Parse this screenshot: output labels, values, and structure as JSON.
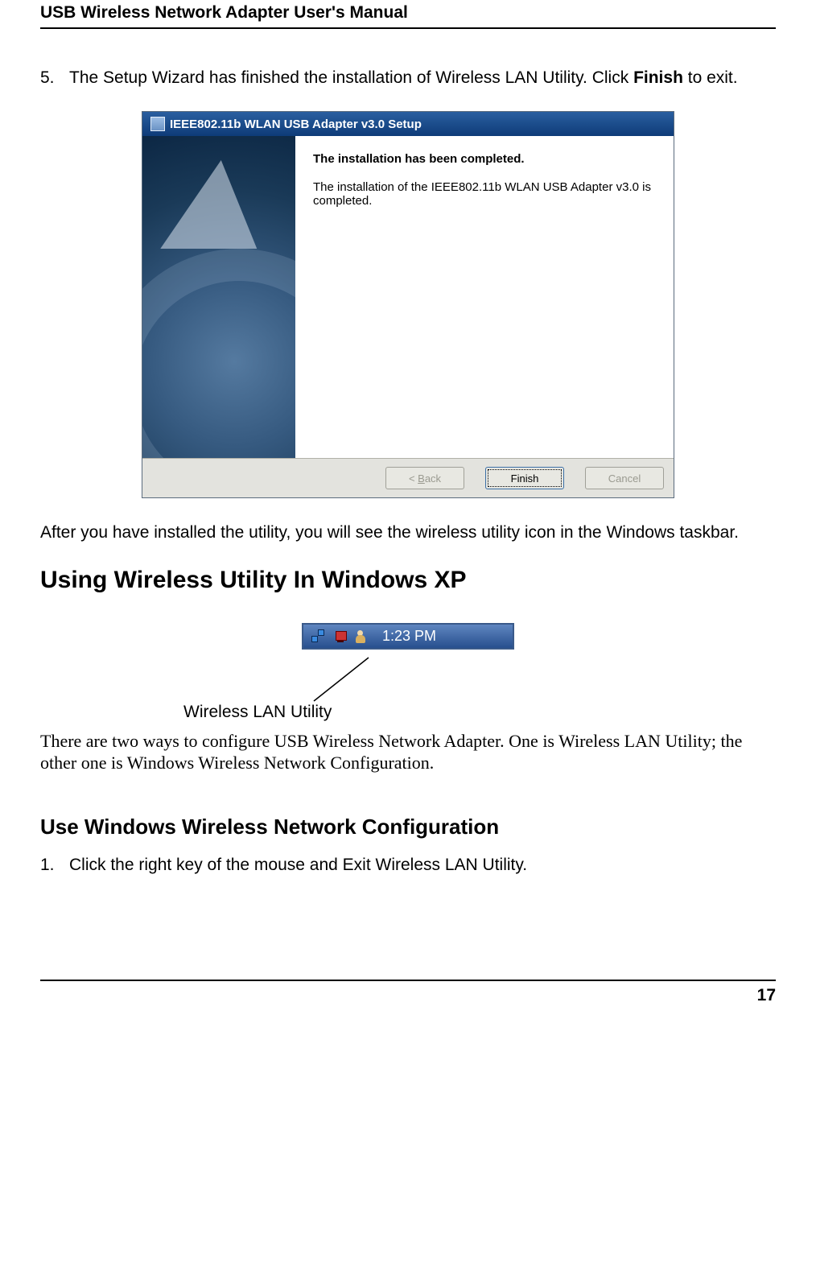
{
  "header": {
    "title": "USB Wireless Network Adapter User's Manual"
  },
  "step5": {
    "number": "5.",
    "text_pre": "The Setup Wizard has finished the installation of Wireless LAN Utility. Click ",
    "text_bold": "Finish",
    "text_post": " to exit."
  },
  "installer": {
    "title": "IEEE802.11b WLAN USB Adapter v3.0 Setup",
    "headline": "The installation has been completed.",
    "body": "The installation of the IEEE802.11b WLAN USB Adapter v3.0 is completed.",
    "btn_back": "< Back",
    "btn_finish": "Finish",
    "btn_cancel": "Cancel"
  },
  "after_text": "After you have installed the utility, you will see the wireless utility icon in the Windows taskbar.",
  "heading_xp": "Using Wireless Utility In Windows XP",
  "tray": {
    "time": "1:23 PM"
  },
  "callout_label": "Wireless LAN Utility",
  "two_ways": "There are two ways to configure USB Wireless Network Adapter. One is Wireless LAN Utility; the other one is Windows Wireless Network Configuration.",
  "heading_config": "Use Windows Wireless Network Configuration",
  "step1": {
    "number": "1.",
    "text": "Click the right key of the mouse and Exit Wireless LAN Utility."
  },
  "page_number": "17"
}
